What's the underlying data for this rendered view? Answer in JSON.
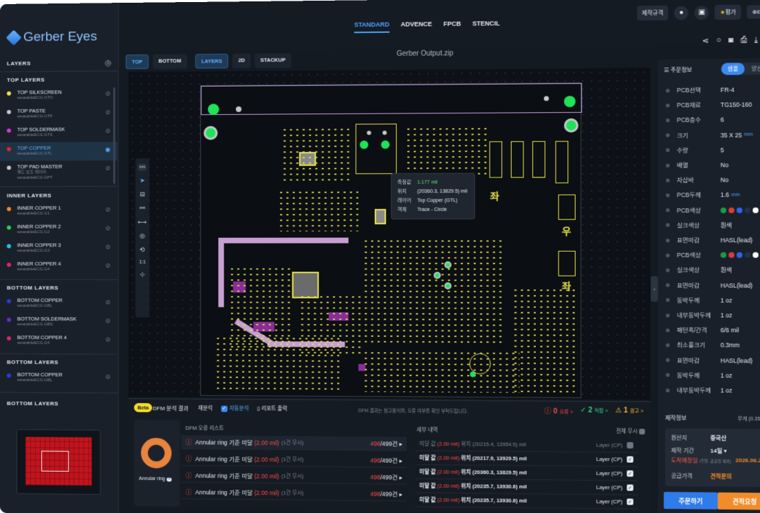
{
  "app": {
    "name": "Gerber Eyes"
  },
  "nav": {
    "tabs": [
      "STANDARD",
      "ADVENCE",
      "FPCB",
      "STENCIL"
    ],
    "active": "STANDARD",
    "rule_btn": "제작규격",
    "rating_btn": "평가",
    "lang_btn": "EN"
  },
  "viewbar": {
    "top": "TOP",
    "bottom": "BOTTOM",
    "layers": "LAYERS",
    "mode2d": "2D",
    "stackup": "STACKUP"
  },
  "file_name": "Gerber Output.zip",
  "sidebar": {
    "header": "LAYERS",
    "top_title": "TOP LAYERS",
    "top_layers": [
      {
        "name": "TOP SILKSCREEN",
        "file": "wearableECG.GTO",
        "color": "#f5e63a"
      },
      {
        "name": "TOP PASTE",
        "file": "wearableECG.GTP",
        "color": "#c9c9c9"
      },
      {
        "name": "TOP SOLDERMASK",
        "file": "wearableECG.GTS",
        "color": "#d63ad6"
      },
      {
        "name": "TOP COPPER",
        "file": "wearableECG.GTL",
        "color": "#e8232f"
      },
      {
        "name": "TOP PAD MASTER",
        "sub": "패드 보조 레이어",
        "file": "wearableECG.GPT",
        "color": "#c9c9c9"
      }
    ],
    "inner_title": "INNER LAYERS",
    "inner_layers": [
      {
        "name": "INNER COPPER 1",
        "file": "wearableECG.G1",
        "color": "#f08c2a"
      },
      {
        "name": "INNER COPPER 2",
        "file": "wearableECG.G2",
        "color": "#33d154"
      },
      {
        "name": "INNER COPPER 3",
        "file": "wearableECG.G3",
        "color": "#24c9e8"
      },
      {
        "name": "INNER COPPER 4",
        "file": "wearableECG.G4",
        "color": "#e8236a"
      }
    ],
    "bottom_title": "BOTTOM LAYERS",
    "bottom_layers": [
      {
        "name": "BOTTOM COPPER",
        "file": "wearableECG.GBL",
        "color": "#2b3ae8"
      },
      {
        "name": "BOTTOM SOLDERMASK",
        "file": "wearableECG.GBS",
        "color": "#6a2ad6"
      },
      {
        "name": "BOTTOM COPPER 4",
        "file": "wearableECG.G4",
        "color": "#e8236a"
      }
    ],
    "bottom2_title": "BOTTOM LAYERS",
    "bottom2_layers": [
      {
        "name": "BOTTOM COPPER",
        "file": "wearableECG.GBL",
        "color": "#2b3ae8"
      }
    ],
    "bottom3_title": "BOTTOM LAYERS"
  },
  "toolstrip": {
    "unit": "mm",
    "ratio": "1:1"
  },
  "tooltip": {
    "measure_label": "측정값",
    "measure_value": "1.177 mil",
    "pos_label": "위치",
    "pos_value": "(20360.3, 13829.5) mil",
    "layer_label": "레이어",
    "layer_value": "Top Copper (GTL)",
    "obj_label": "객체",
    "obj_value": "Trace - Circle"
  },
  "board_text": {
    "right_top": "좌",
    "right_mid": "우",
    "right_bottom": "좌"
  },
  "dfm": {
    "beta": "Beta",
    "title": "DFM 분석 결과",
    "reanalyze": "재분석",
    "auto": "자동분석",
    "report": "리포트 출력",
    "note": "DFM 결과는 참고용이며, 오류 여부를 확인 부탁드립니다.",
    "errors": "0",
    "errors_label": "오류 >",
    "pass": "2",
    "pass_label": "적합 >",
    "warn": "1",
    "warn_label": "경고 >",
    "ar_label": "Annular ring",
    "list_title": "DFM 오류 리스트",
    "rows": [
      {
        "text": "Annular ring 기준 미달",
        "val": "(2.00 mil)",
        "ign": "(1건 무시)",
        "count": "498",
        "total": "/499건"
      },
      {
        "text": "Annular ring 기준 미달",
        "val": "(2.00 mil)",
        "ign": "(1건 무시)",
        "count": "498",
        "total": "/499건"
      },
      {
        "text": "Annular ring 기준 미달",
        "val": "(2.00 mil)",
        "ign": "(1건 무시)",
        "count": "498",
        "total": "/499건"
      },
      {
        "text": "Annular ring 기준 미달",
        "val": "(2.00 mil)",
        "ign": "(1건 무시)",
        "count": "498",
        "total": "/499건"
      }
    ],
    "detail_title": "세부 내역",
    "ignore_all": "전체 무시",
    "details": [
      {
        "a": "미달 값",
        "b": "(2.00 mil)",
        "c": "위치 (20215.4, 13954.5) mil",
        "layer": "Layer (CP)"
      },
      {
        "a": "미달 값",
        "b": "(2.00 mil)",
        "c": "위치 (20217.9, 13929.5) mil",
        "layer": "Layer (CP)"
      },
      {
        "a": "미달 값",
        "b": "(2.00 mil)",
        "c": "위치 (20360.3, 13829.5) mil",
        "layer": "Layer (CP)"
      },
      {
        "a": "미달 값",
        "b": "(2.00 mil)",
        "c": "위치 (20235.7, 13930.6) mil",
        "layer": "Layer (CP)"
      },
      {
        "a": "미달 값",
        "b": "(2.00 mil)",
        "c": "위치 (20235.7, 13930.6) mil",
        "layer": "Layer (CP)"
      }
    ]
  },
  "order": {
    "title": "주문정보",
    "seg_sample": "샘플",
    "seg_mass": "양산",
    "props": [
      {
        "k": "PCB선택",
        "v": "FR-4"
      },
      {
        "k": "PCB재료",
        "v": "TG150-160"
      },
      {
        "k": "PCB층수",
        "v": "6"
      },
      {
        "k": "크기",
        "v": "35 X 25",
        "unit": "mm"
      },
      {
        "k": "수량",
        "v": "5"
      },
      {
        "k": "배열",
        "v": "No"
      },
      {
        "k": "자삽바",
        "v": "No"
      },
      {
        "k": "PCB두께",
        "v": "1.6",
        "unit": "mm"
      },
      {
        "k": "PCB색상",
        "v": "",
        "swatches": [
          "#1b9a4a",
          "#e23a3a",
          "#2a66e8",
          "#22324a",
          "#ffffff",
          "#f4c21d"
        ]
      },
      {
        "k": "실크색상",
        "v": "흰색"
      },
      {
        "k": "표면마감",
        "v": "HASL(lead)"
      },
      {
        "k": "PCB색상",
        "v": "",
        "swatches": [
          "#1b9a4a",
          "#e23a3a",
          "#2a66e8",
          "#22324a",
          "#ffffff",
          "#f4c21d"
        ]
      },
      {
        "k": "실크색상",
        "v": "흰색"
      },
      {
        "k": "표면마감",
        "v": "HASL(lead)"
      },
      {
        "k": "동박두께",
        "v": "1 oz"
      },
      {
        "k": "내부동박두께",
        "v": "1 oz"
      },
      {
        "k": "패턴폭/간격",
        "v": "6/6 mil"
      },
      {
        "k": "최소홀크기",
        "v": "0.3mm"
      },
      {
        "k": "표면마감",
        "v": "HASL(lead)"
      },
      {
        "k": "동박두께",
        "v": "1 oz"
      },
      {
        "k": "내부동박두께",
        "v": "1 oz"
      }
    ],
    "prod_title": "제작정보",
    "weight": "무게 (0.35 kg)",
    "origin_k": "원산지",
    "origin_v": "중국산",
    "period_k": "제작 기간",
    "period_v": "14일 ▾",
    "eta_k": "도착예정일",
    "eta_note": "(주말, 공휴일 제외)",
    "eta_v": "2026.06.29",
    "price_k": "공급가격",
    "price_v": "견적문의",
    "order_btn": "주문하기",
    "quote_btn": "견적요청"
  }
}
